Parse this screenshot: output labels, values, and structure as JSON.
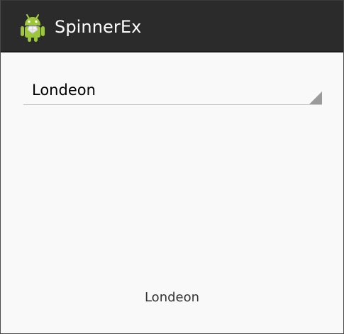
{
  "app": {
    "title": "SpinnerEx",
    "icon": "android-robot-icon"
  },
  "spinner": {
    "selected_value": "Londeon"
  },
  "result": {
    "text": "Londeon"
  },
  "colors": {
    "action_bar": "#2b2b2b",
    "background": "#f9f9f9",
    "title_text": "#ffffff",
    "spinner_line": "#c8c8c8",
    "spinner_arrow": "#9b9b9b",
    "android_green": "#9ec63b"
  }
}
